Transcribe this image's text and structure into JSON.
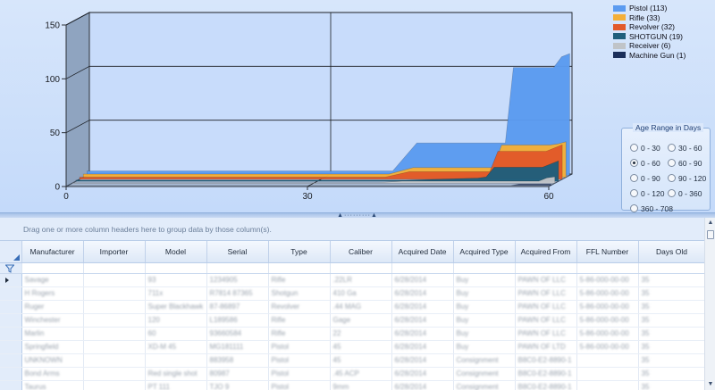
{
  "chart_data": {
    "type": "area",
    "title": "",
    "xlabel": "",
    "ylabel": "",
    "xlim": [
      0,
      60
    ],
    "ylim": [
      0,
      150
    ],
    "x_ticks": [
      0,
      30,
      60
    ],
    "y_ticks": [
      0,
      50,
      100,
      150
    ],
    "grid": true,
    "legend_position": "top-right",
    "series": [
      {
        "name": "Pistol (113)",
        "color": "#5b9bf0",
        "x": [
          0,
          38,
          41,
          52,
          53,
          58,
          59,
          60
        ],
        "y": [
          4,
          4,
          30,
          30,
          100,
          100,
          110,
          113
        ]
      },
      {
        "name": "Rifle (33)",
        "color": "#f4b03a",
        "x": [
          0,
          38,
          41,
          51,
          52,
          58,
          59,
          60
        ],
        "y": [
          3,
          3,
          9,
          9,
          30,
          30,
          31,
          33
        ]
      },
      {
        "name": "Revolver (32)",
        "color": "#e25a2a",
        "x": [
          0,
          38,
          41,
          51,
          52,
          58,
          59,
          60
        ],
        "y": [
          2,
          2,
          7,
          7,
          26,
          26,
          29,
          32
        ]
      },
      {
        "name": "SHOTGUN (19)",
        "color": "#1f5f7c",
        "x": [
          0,
          41,
          50,
          51,
          52,
          58,
          59,
          60
        ],
        "y": [
          1,
          1,
          3,
          4,
          13,
          13,
          16,
          19
        ]
      },
      {
        "name": "Receiver (6)",
        "color": "#c0c4c8",
        "x": [
          0,
          38,
          41,
          58,
          59,
          60
        ],
        "y": [
          0.5,
          0.5,
          2,
          2,
          5,
          6
        ]
      },
      {
        "name": "Machine Gun (1)",
        "color": "#1b2f5a",
        "x": [
          0,
          55,
          56,
          60
        ],
        "y": [
          0,
          0,
          1,
          1
        ]
      }
    ]
  },
  "age_range": {
    "title": "Age Range in Days",
    "options": [
      {
        "label": "0 - 30",
        "checked": false
      },
      {
        "label": "30 - 60",
        "checked": false
      },
      {
        "label": "0 - 60",
        "checked": true
      },
      {
        "label": "60 - 90",
        "checked": false
      },
      {
        "label": "0 - 90",
        "checked": false
      },
      {
        "label": "90 - 120",
        "checked": false
      },
      {
        "label": "0 - 120",
        "checked": false
      },
      {
        "label": "0 - 360",
        "checked": false
      },
      {
        "label": "360 - 708",
        "checked": false
      }
    ]
  },
  "grid": {
    "group_hint": "Drag one or more column headers here to group data by those column(s).",
    "columns": [
      "Manufacturer",
      "Importer",
      "Model",
      "Serial",
      "Type",
      "Caliber",
      "Acquired Date",
      "Acquired Type",
      "Acquired From",
      "FFL Number",
      "Days Old"
    ],
    "rows": [
      [
        "Savage",
        "",
        "93",
        "1234905",
        "Rifle",
        ".22LR",
        "6/28/2014",
        "Buy",
        "PAWN OF LLC",
        "5-86-000-00-00",
        "35"
      ],
      [
        "H Rogers",
        "",
        "711x",
        "R7814 87365",
        "Shotgun",
        "410 Ga",
        "6/28/2014",
        "Buy",
        "PAWN OF LLC",
        "5-86-000-00-00",
        "35"
      ],
      [
        "Ruger",
        "",
        "Super Blackhawk",
        "87-86897",
        "Revolver",
        ".44 MAG",
        "6/28/2014",
        "Buy",
        "PAWN OF LLC",
        "5-86-000-00-00",
        "35"
      ],
      [
        "Winchester",
        "",
        "120",
        "L189586",
        "Rifle",
        "Gage",
        "6/28/2014",
        "Buy",
        "PAWN OF LLC",
        "5-86-000-00-00",
        "35"
      ],
      [
        "Marlin",
        "",
        "60",
        "93660584",
        "Rifle",
        "22",
        "6/28/2014",
        "Buy",
        "PAWN OF LLC",
        "5-86-000-00-00",
        "35"
      ],
      [
        "Springfield",
        "",
        "XD-M 45",
        "MG181111",
        "Pistol",
        "45",
        "6/28/2014",
        "Buy",
        "PAWN OF LTD",
        "5-86-000-00-00",
        "35"
      ],
      [
        "UNKNOWN",
        "",
        "",
        "883958",
        "Pistol",
        "45",
        "6/28/2014",
        "Consignment",
        "B8C0-E2-8890-1",
        "",
        "35"
      ],
      [
        "Bond Arms",
        "",
        "Red single shot",
        "80987",
        "Pistol",
        ".45 ACP",
        "6/28/2014",
        "Consignment",
        "B8C0-E2-8890-1",
        "",
        "35"
      ],
      [
        "Taurus",
        "",
        "PT 111",
        "TJO 9",
        "Pistol",
        "9mm",
        "6/28/2014",
        "Consignment",
        "B8C0-E2-8890-1",
        "",
        "35"
      ]
    ]
  }
}
